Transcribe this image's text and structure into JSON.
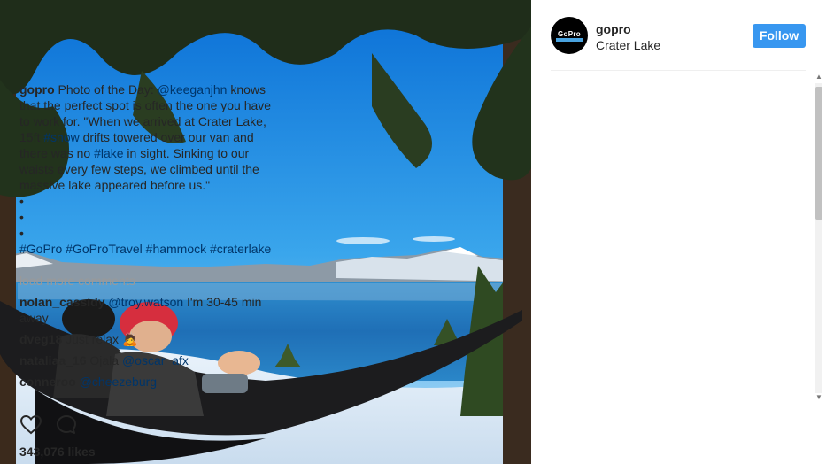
{
  "post": {
    "username": "gopro",
    "location": "Crater Lake",
    "follow_label": "Follow",
    "avatar_text": "GoPro"
  },
  "caption": {
    "username": "gopro",
    "text_1": " Photo of the Day: ",
    "mention": "@keeganjhn",
    "text_2": " knows that the perfect spot is often the one you have to work for. \"When we arrived at Crater Lake, 15ft ",
    "tag_snow": "#snow",
    "text_3": " drifts towered over our van and there was no ",
    "tag_lake": "#lake",
    "text_4": " in sight. Sinking to our waists every few steps, we climbed until the massive lake appeared before us.\"",
    "bullets": [
      "•",
      "•",
      "•"
    ],
    "tags": [
      "#GoPro",
      "#GoProTravel",
      "#hammock",
      "#craterlake"
    ]
  },
  "load_more": "load more comments",
  "comments": [
    {
      "username": "nolan_cassidy",
      "mention": "@troy.watson",
      "text": " I'm 30-45 min away"
    },
    {
      "username": "dveg18",
      "mention": "",
      "text": " Just relax 🙇"
    },
    {
      "username": "nataliaa_16",
      "mention": "@oscar_afx",
      "text": " Ojala "
    },
    {
      "username": "conneroo",
      "mention": "@cheezeburg",
      "text": ""
    }
  ],
  "likes": "343,076 likes",
  "icons": {
    "like": "heart-outline-icon",
    "comment": "speech-bubble-icon"
  },
  "colors": {
    "follow_button": "#3897f0",
    "link": "#003569",
    "muted": "#999999"
  }
}
